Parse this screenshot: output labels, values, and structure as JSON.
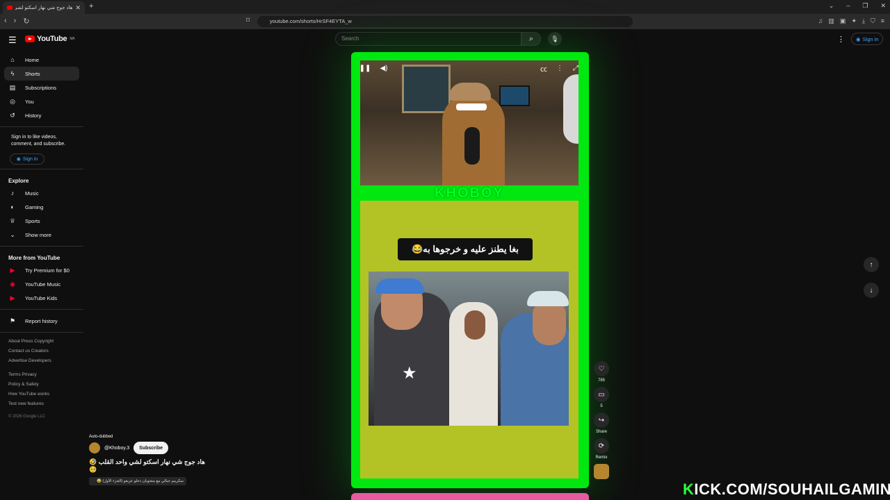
{
  "browser": {
    "tab_title": "هاد جوج شي نهار اسكتو لشي واحد القلب 🤣🥺",
    "tab_close": "✕",
    "new_tab": "+",
    "url": "youtube.com/shorts/HrSF4EYTA_w"
  },
  "header": {
    "logo_text": "YouTube",
    "logo_region": "MA",
    "search_placeholder": "Search",
    "signin_label": "Sign in"
  },
  "sidebar": {
    "main": [
      {
        "label": "Home",
        "icon": "home-icon"
      },
      {
        "label": "Shorts",
        "icon": "shorts-icon"
      },
      {
        "label": "Subscriptions",
        "icon": "subscriptions-icon"
      },
      {
        "label": "You",
        "icon": "you-icon"
      },
      {
        "label": "History",
        "icon": "history-icon"
      }
    ],
    "signin_note": "Sign in to like videos, comment, and subscribe.",
    "signin_label": "Sign in",
    "explore_heading": "Explore",
    "explore": [
      {
        "label": "Music",
        "icon": "music-icon"
      },
      {
        "label": "Gaming",
        "icon": "gaming-icon"
      },
      {
        "label": "Sports",
        "icon": "sports-icon"
      },
      {
        "label": "Show more",
        "icon": "chevron-down-icon"
      }
    ],
    "more_heading": "More from YouTube",
    "more": [
      {
        "label": "Try Premium for $0"
      },
      {
        "label": "YouTube Music"
      },
      {
        "label": "YouTube Kids"
      }
    ],
    "report_history": "Report history",
    "footer1": "About  Press  Copyright",
    "footer2": "Contact us  Creators",
    "footer3": "Advertise  Developers",
    "footer4": "Terms  Privacy",
    "footer5": "Policy & Safety",
    "footer6": "How YouTube works",
    "footer7": "Test new features",
    "copyright": "© 2026 Google LLC"
  },
  "video": {
    "brand_text": "KHOBOY",
    "caption": "بغا يطنز عليه و خرجوها به😂"
  },
  "actions": {
    "likes": "785",
    "comments": "5",
    "share_label": "Share",
    "remix_label": "Remix"
  },
  "meta": {
    "auto_dubbed": "Auto-dubbed",
    "channel": "@Khoboy.3",
    "subscribe_label": "Subscribe",
    "title": "هاد جوج شي نهار اسكتو لشي واحد القلب 🤣🥺",
    "song": "سكريبم جبالي مع متجويان دخلو عزيعو (الجزء الأول) 😂"
  },
  "watermark": {
    "first_letter": "K",
    "rest": "ICK.COM/SOUHAILGAMING"
  },
  "colors": {
    "frame_green": "#00e80f",
    "background": "#0f0f0f",
    "youtube_red": "#ff0000",
    "link_blue": "#3ea6ff"
  }
}
